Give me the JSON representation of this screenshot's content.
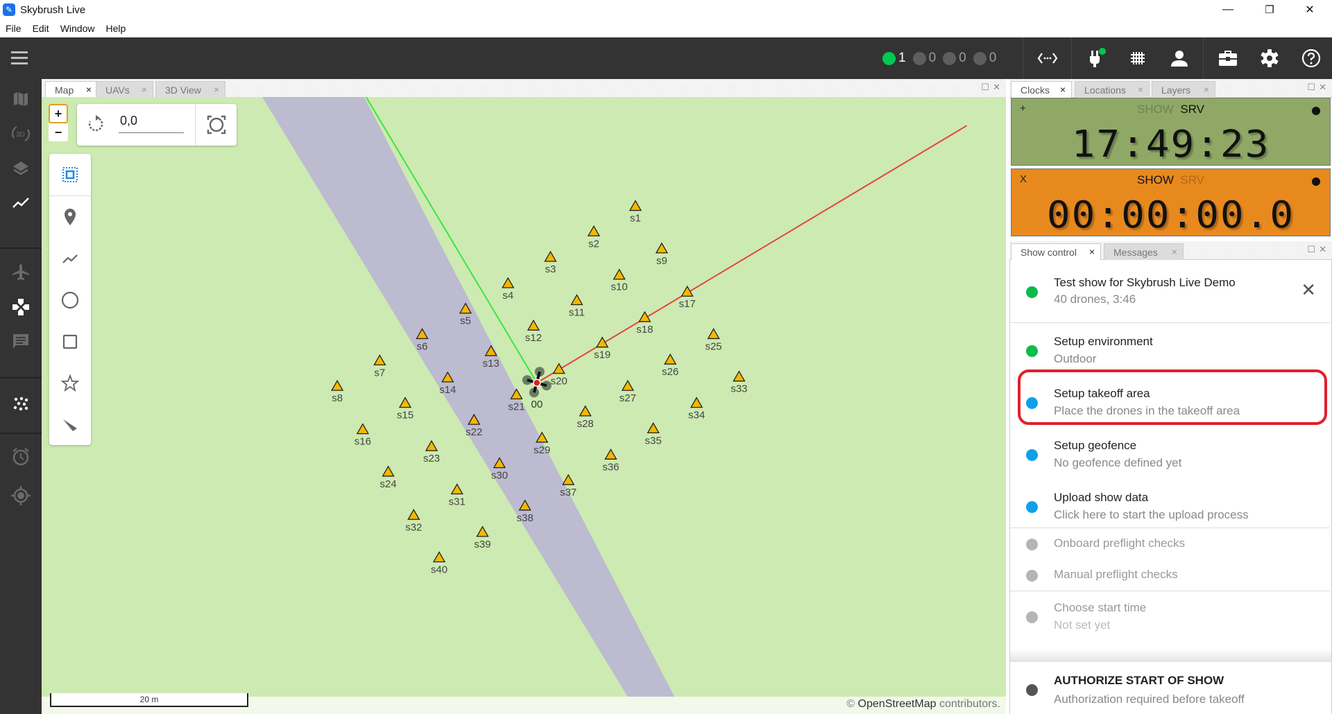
{
  "window": {
    "title": "Skybrush Live",
    "controls": {
      "minimize": "—",
      "restore": "❐",
      "close": "✕"
    }
  },
  "menu": [
    "File",
    "Edit",
    "Window",
    "Help"
  ],
  "toolbar": {
    "status_counts": [
      {
        "color": "#00c853",
        "count": "1"
      },
      {
        "color": "#5e5e5e",
        "count": "0"
      },
      {
        "color": "#5e5e5e",
        "count": "0"
      },
      {
        "color": "#5e5e5e",
        "count": "0"
      }
    ],
    "connection_status_color": "#00c853",
    "icons": [
      "code-brackets-icon",
      "plug-icon",
      "grid-icon",
      "person-icon",
      "toolbox-icon",
      "gear-icon",
      "help-icon"
    ]
  },
  "sidebar": {
    "items": [
      "map-icon",
      "3d-view-icon",
      "layers-icon",
      "chart-icon",
      "plane-icon",
      "gamepad-icon",
      "messages-icon",
      "drone-swarm-icon",
      "alarm-icon",
      "locate-icon"
    ],
    "active": [
      "chart-icon",
      "gamepad-icon",
      "drone-swarm-icon"
    ]
  },
  "map_panel": {
    "tabs": [
      {
        "label": "Map",
        "close": "×",
        "active": true
      },
      {
        "label": "UAVs",
        "close": "×",
        "active": false
      },
      {
        "label": "3D View",
        "close": "×",
        "active": false
      }
    ],
    "zoom_in": "+",
    "zoom_out": "−",
    "rotation_value": "0,0",
    "tools": [
      "select-box-icon",
      "marker-icon",
      "polyline-icon",
      "circle-icon",
      "rectangle-icon",
      "star-icon",
      "pointer-icon"
    ],
    "scale_label": "20 m",
    "attribution_symbol": "©",
    "attribution_link": "OpenStreetMap",
    "attribution_text": "contributors.",
    "uav_label": "00",
    "takeoff_markers": [
      "s1",
      "s2",
      "s3",
      "s4",
      "s5",
      "s6",
      "s7",
      "s8",
      "s9",
      "s10",
      "s11",
      "s12",
      "s13",
      "s14",
      "s15",
      "s16",
      "s17",
      "s18",
      "s19",
      "s20",
      "s21",
      "s22",
      "s23",
      "s24",
      "s25",
      "s26",
      "s27",
      "s28",
      "s29",
      "s30",
      "s31",
      "s32",
      "s33",
      "s34",
      "s35",
      "s36",
      "s37",
      "s38",
      "s39",
      "s40"
    ],
    "colors": {
      "land": "#cdeab2",
      "road": "#bcbbd0",
      "marker": "#f5b800",
      "heading_line": "#3ce63c",
      "direction_line": "#e5453f"
    }
  },
  "clocks_panel": {
    "tabs": [
      {
        "label": "Clocks",
        "close": "×",
        "active": true
      },
      {
        "label": "Locations",
        "close": "×",
        "active": false
      },
      {
        "label": "Layers",
        "close": "×",
        "active": false
      }
    ],
    "clocks": [
      {
        "flag": "+",
        "label_show": "SHOW",
        "label_srv": "SRV",
        "active_label": "SRV",
        "time": "17:49:23",
        "bg": "#8fa866"
      },
      {
        "flag": "X",
        "label_show": "SHOW",
        "label_srv": "SRV",
        "active_label": "SHOW",
        "time": "00:00:00.0",
        "bg": "#e8891e"
      }
    ]
  },
  "show_control_panel": {
    "tabs": [
      {
        "label": "Show control",
        "close": "×",
        "active": true
      },
      {
        "label": "Messages",
        "close": "×",
        "active": false
      }
    ],
    "show": {
      "title": "Test show for Skybrush Live Demo",
      "subtitle": "40 drones, 3:46",
      "status": "green",
      "close": "✕"
    },
    "steps": [
      {
        "title": "Setup environment",
        "subtitle": "Outdoor",
        "status": "green"
      },
      {
        "title": "Setup takeoff area",
        "subtitle": "Place the drones in the takeoff area",
        "status": "blue",
        "highlighted": true
      },
      {
        "title": "Setup geofence",
        "subtitle": "No geofence defined yet",
        "status": "blue"
      },
      {
        "title": "Upload show data",
        "subtitle": "Click here to start the upload process",
        "status": "blue"
      },
      {
        "title": "Onboard preflight checks",
        "subtitle": "",
        "status": "gray"
      },
      {
        "title": "Manual preflight checks",
        "subtitle": "",
        "status": "gray"
      },
      {
        "title": "Choose start time",
        "subtitle": "Not set yet",
        "status": "gray"
      }
    ],
    "authorize": {
      "title": "AUTHORIZE START OF SHOW",
      "subtitle": "Authorization required before takeoff",
      "status": "dark"
    },
    "status_colors": {
      "green": "#0dbb4c",
      "blue": "#0fa0e8",
      "gray": "#b5b5b5",
      "dark": "#555555"
    }
  }
}
